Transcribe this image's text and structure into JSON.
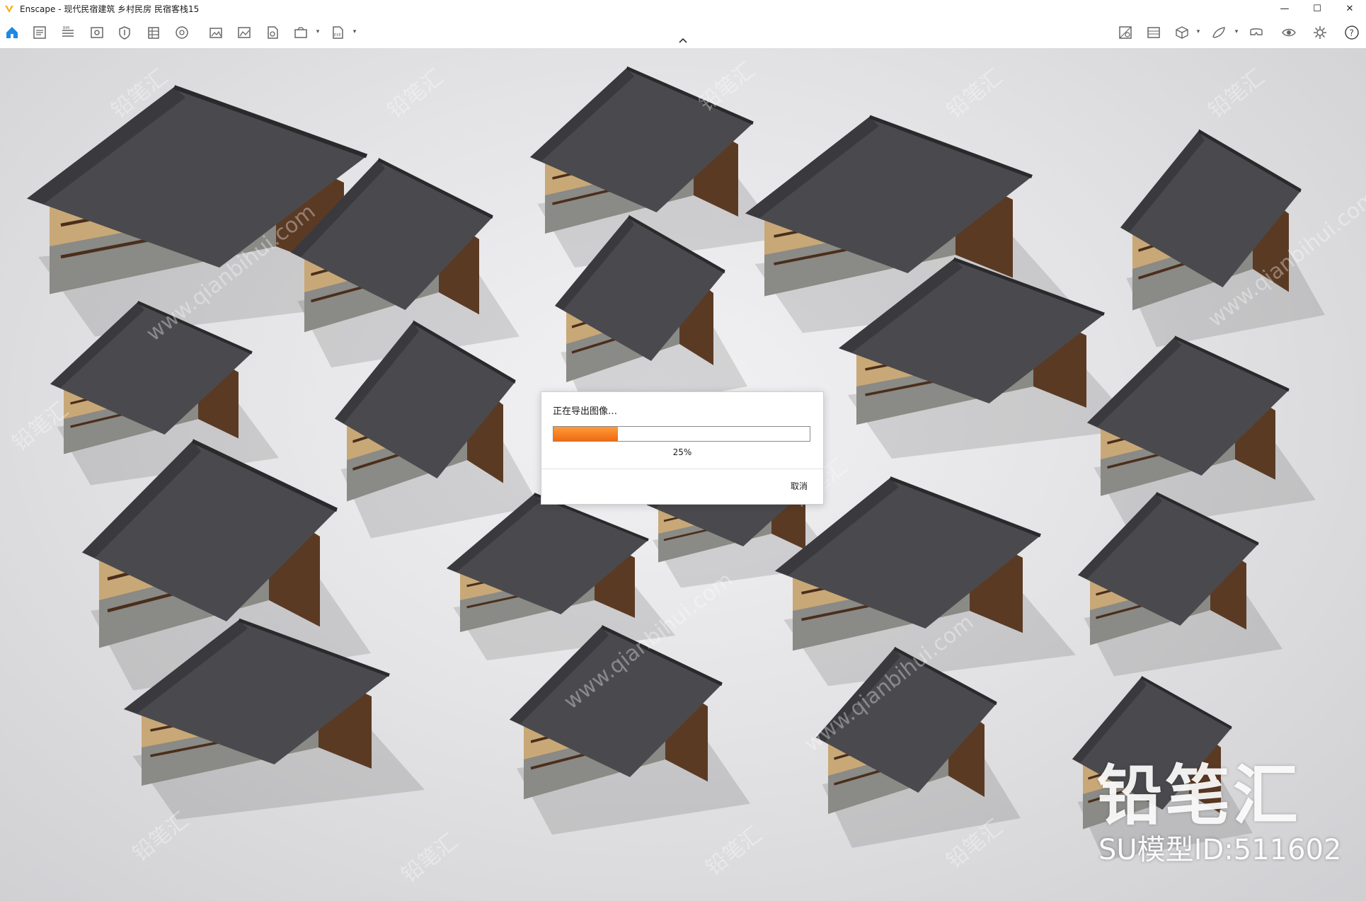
{
  "window": {
    "title": "Enscape - 现代民宿建筑 乡村民房 民宿客栈15",
    "controls": [
      "minimize-icon",
      "maximize-icon",
      "close-icon"
    ]
  },
  "toolbar": {
    "left_icons": [
      "home-icon",
      "asset-library-icon",
      "bim-icon",
      "views-icon",
      "visual-settings-icon",
      "objects-icon",
      "panorama-icon",
      "render-image-icon",
      "batch-render-icon",
      "video-icon",
      "export-icon",
      "exe-export-icon"
    ],
    "right_icons": [
      "material-editor-icon",
      "rendering-tools-icon",
      "cube-icon",
      "feedback-icon",
      "vr-headset-icon",
      "visibility-icon",
      "settings-icon",
      "help-icon"
    ],
    "accent": "#1e88e5"
  },
  "dialog": {
    "title": "正在导出图像…",
    "progress_percent_label": "25%",
    "progress": 0.25,
    "cancel_label": "取消",
    "progress_color": "#f27a1a"
  },
  "watermark": {
    "logo": "铅笔汇",
    "model_id": "SU模型ID:511602",
    "tile_text": "www.qianbihui.com",
    "tile_text_cn": "铅笔汇"
  }
}
